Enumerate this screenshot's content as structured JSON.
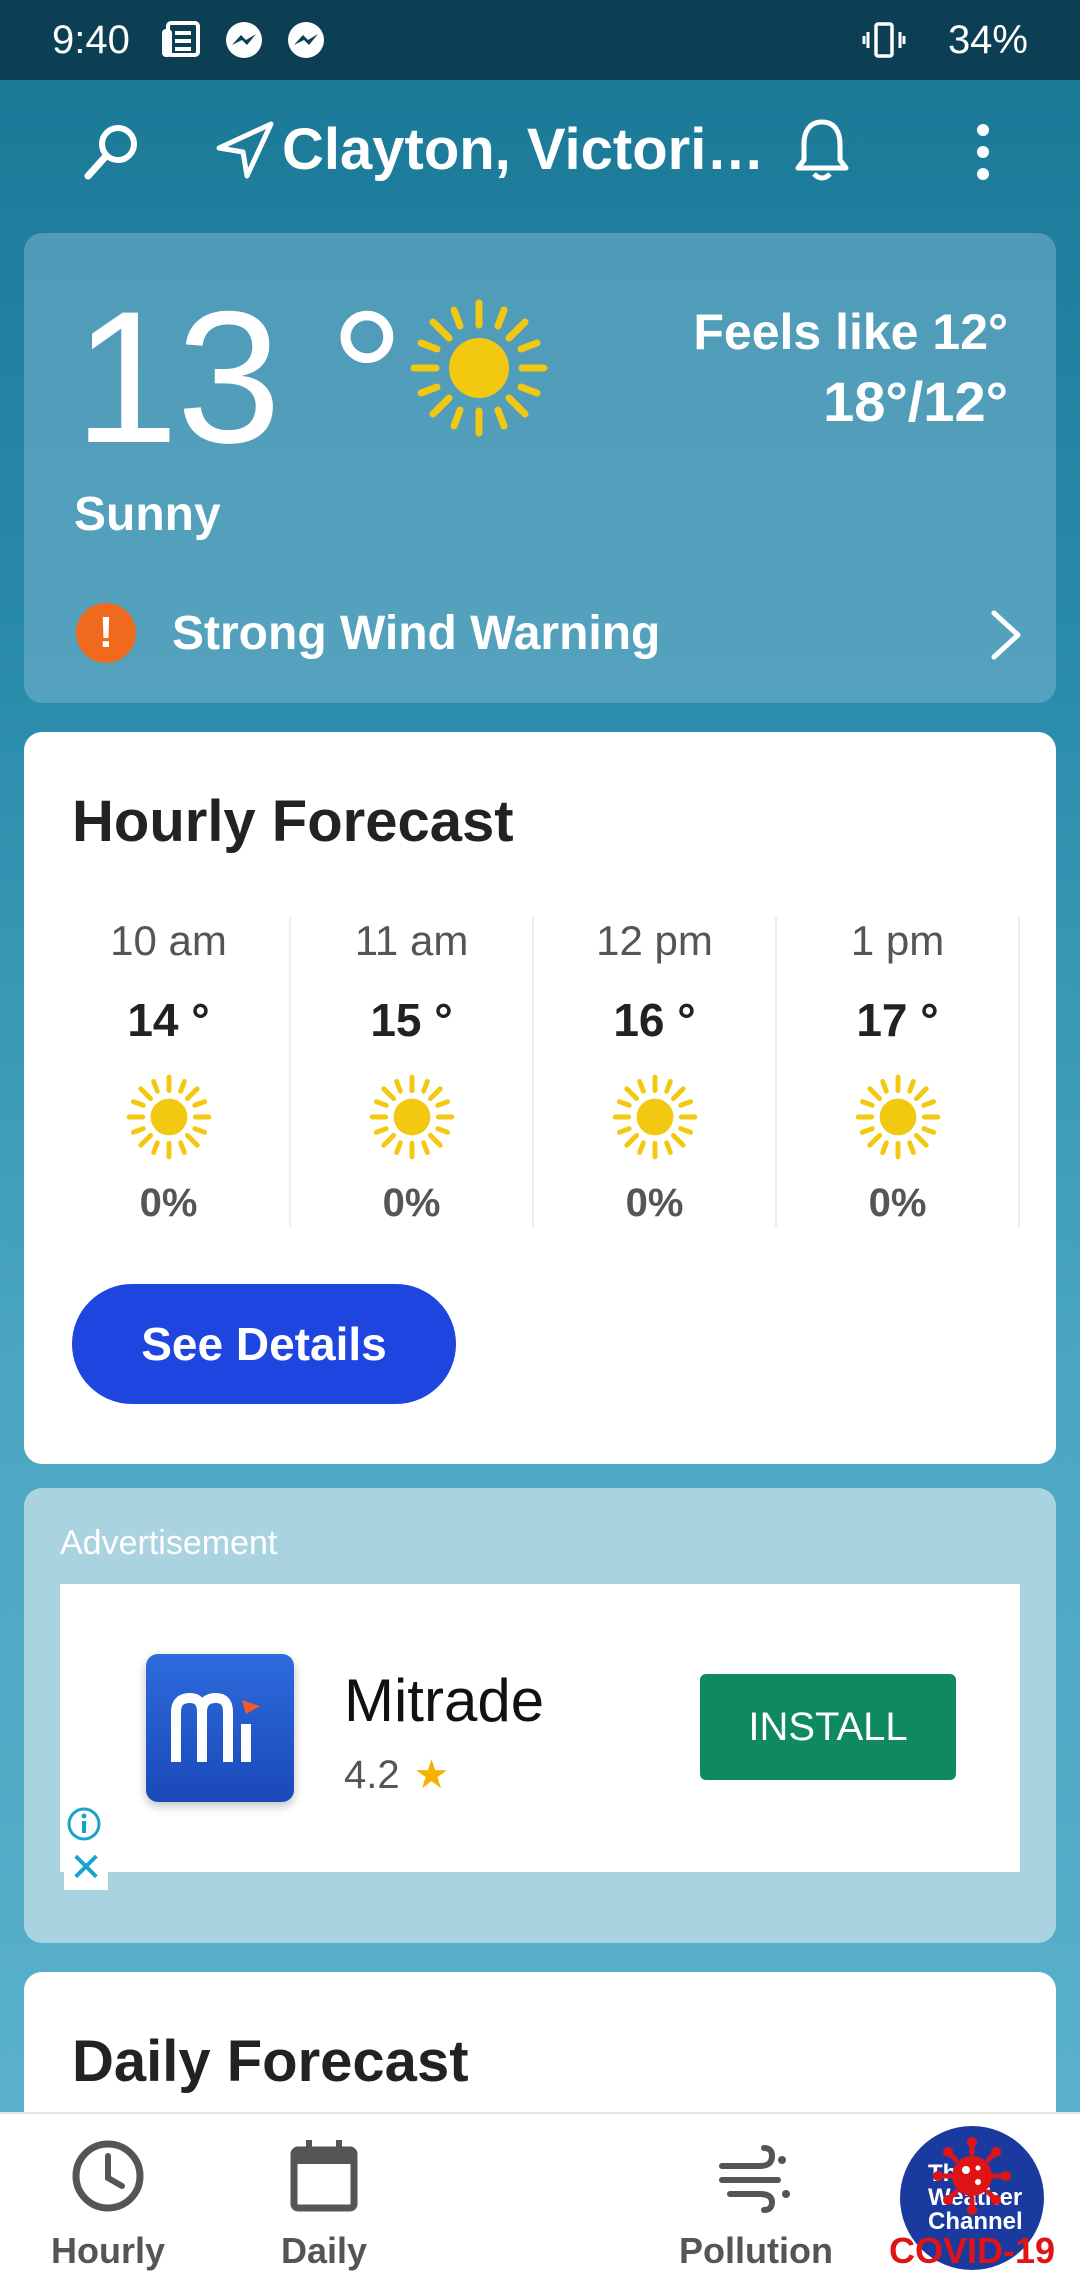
{
  "status_bar": {
    "time": "9:40",
    "battery": "34%",
    "left_icons": [
      "news-icon",
      "messenger-icon",
      "messenger-icon"
    ],
    "right_icons": [
      "vibrate-icon"
    ]
  },
  "app_bar": {
    "location": "Clayton, Victori…",
    "icons": [
      "search-icon",
      "location-arrow-icon",
      "bell-icon",
      "more-vert-icon"
    ]
  },
  "current": {
    "temperature": "13 °",
    "feels_like": "Feels like 12°",
    "high_low": "18°/12°",
    "condition": "Sunny",
    "icon": "sun-icon",
    "warning_icon": "!",
    "warning": "Strong Wind Warning"
  },
  "hourly": {
    "title": "Hourly Forecast",
    "hours": [
      {
        "time": "10 am",
        "temp": "14 °",
        "precip": "0%",
        "icon": "sun-icon"
      },
      {
        "time": "11 am",
        "temp": "15 °",
        "precip": "0%",
        "icon": "sun-icon"
      },
      {
        "time": "12 pm",
        "temp": "16 °",
        "precip": "0%",
        "icon": "sun-icon"
      },
      {
        "time": "1 pm",
        "temp": "17 °",
        "precip": "0%",
        "icon": "sun-icon"
      }
    ],
    "button": "See Details"
  },
  "ad": {
    "label": "Advertisement",
    "app_name": "Mitrade",
    "rating": "4.2",
    "rating_icon": "★",
    "install": "INSTALL",
    "close_glyph": "✕"
  },
  "daily": {
    "title": "Daily Forecast"
  },
  "bottom_nav": {
    "items": [
      {
        "label": "Hourly",
        "icon": "clock-icon"
      },
      {
        "label": "Daily",
        "icon": "calendar-icon"
      },
      {
        "label": "The Weather Channel",
        "line1": "The",
        "line2": "Weather",
        "line3": "Channel"
      },
      {
        "label": "Pollution",
        "icon": "wind-icon"
      },
      {
        "label": "COVID-19",
        "icon": "virus-icon"
      }
    ]
  },
  "colors": {
    "accent_button": "#1e45e0",
    "install_button": "#0f8a5f",
    "warning": "#ef6a1e",
    "covid": "#e01414",
    "sun": "#f2c811"
  }
}
